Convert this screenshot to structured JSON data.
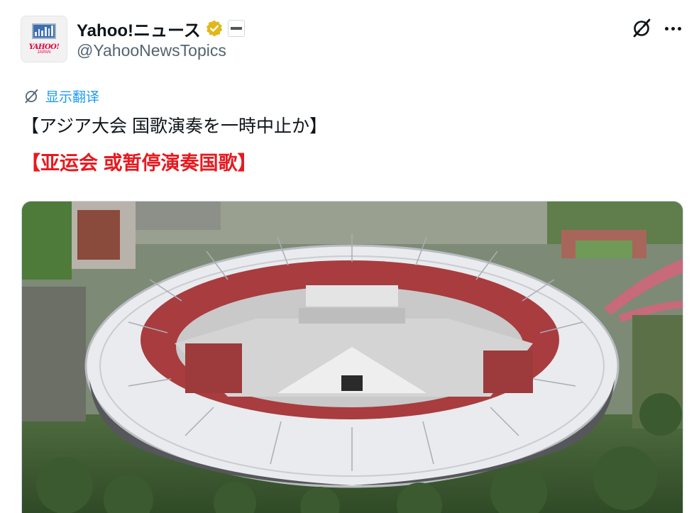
{
  "author": {
    "display_name": "Yahoo!ニュース",
    "handle": "@YahooNewsTopics",
    "avatar_logo_text": "YAHOO!",
    "avatar_logo_sub": "JAPAN"
  },
  "icons": {
    "verified": "verified-badge-gold",
    "affiliate": "affiliate-badge",
    "grok": "grok-icon",
    "more": "more-options-icon",
    "translate": "translate-icon"
  },
  "post": {
    "translate_label": "显示翻译",
    "text_line_1": "【アジア大会 国歌演奏を一時中止か】",
    "text_line_2": "【亚运会 或暂停演奏国歌】"
  },
  "media": {
    "description_icon": "stadium-photo"
  },
  "colors": {
    "link": "#1d9bf0",
    "highlight_red": "#e8191f",
    "verified_gold": "#e2b719",
    "text": "#0f1419",
    "secondary_text": "#536471"
  }
}
